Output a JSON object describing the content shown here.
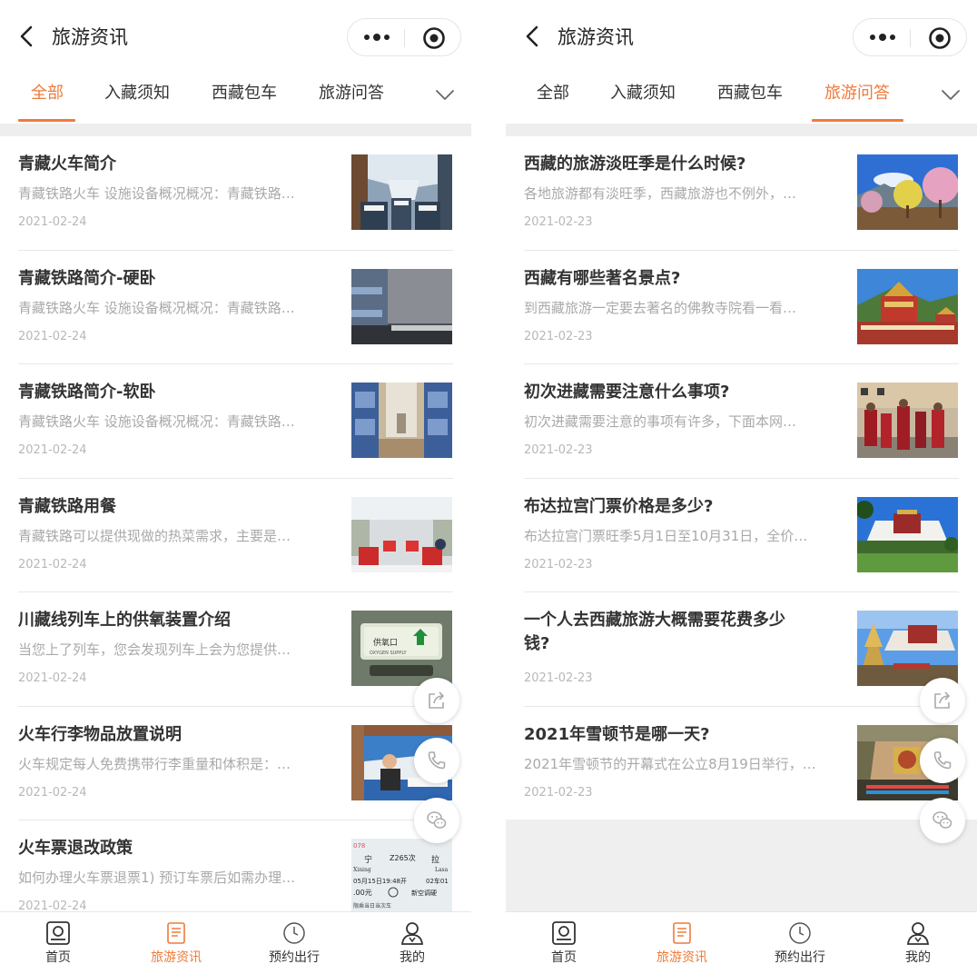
{
  "colors": {
    "accent": "#ef7a3a",
    "title": "#333333",
    "desc": "#a9a9a9",
    "date": "#b8b8b8"
  },
  "panels": [
    {
      "nav_title": "旅游资讯",
      "tabs": [
        "全部",
        "入藏须知",
        "西藏包车",
        "旅游问答"
      ],
      "active_tab": 0,
      "items": [
        {
          "title": "青藏火车简介",
          "desc": "青藏铁路火车 设施设备概况概况：青藏铁路…",
          "date": "2021-02-24",
          "image": "train-seats"
        },
        {
          "title": "青藏铁路简介-硬卧",
          "desc": "青藏铁路火车 设施设备概况概况：青藏铁路…",
          "date": "2021-02-24",
          "image": "hard-sleeper"
        },
        {
          "title": "青藏铁路简介-软卧",
          "desc": "青藏铁路火车 设施设备概况概况：青藏铁路…",
          "date": "2021-02-24",
          "image": "soft-sleeper"
        },
        {
          "title": "青藏铁路用餐",
          "desc": "青藏铁路可以提供现做的热菜需求，主要是…",
          "date": "2021-02-24",
          "image": "dining-car"
        },
        {
          "title": "川藏线列车上的供氧装置介绍",
          "desc": "当您上了列车，您会发现列车上会为您提供…",
          "date": "2021-02-24",
          "image": "oxygen-supply"
        },
        {
          "title": "火车行李物品放置说明",
          "desc": "火车规定每人免费携带行李重量和体积是：…",
          "date": "2021-02-24",
          "image": "train-window"
        },
        {
          "title": "火车票退改政策",
          "desc": "如何办理火车票退票1) 预订车票后如需办理…",
          "date": "2021-02-24",
          "image": "ticket"
        }
      ],
      "oxygen_label": "供氧口",
      "oxygen_sub": "OXYGEN SUPPLY",
      "ticket_text": [
        "078",
        "宁",
        "Z265次",
        "拉",
        "Xining",
        "Lasa",
        "05月15日19:48开",
        "02车01",
        ".00元",
        "新空调硬",
        "限乘当日当次车"
      ],
      "bottom_nav": [
        "首页",
        "旅游资讯",
        "预约出行",
        "我的"
      ],
      "bottom_active": 1
    },
    {
      "nav_title": "旅游资讯",
      "tabs": [
        "全部",
        "入藏须知",
        "西藏包车",
        "旅游问答"
      ],
      "active_tab": 3,
      "items": [
        {
          "title": "西藏的旅游淡旺季是什么时候?",
          "desc": "各地旅游都有淡旺季，西藏旅游也不例外，…",
          "date": "2021-02-23",
          "image": "spring-blossom"
        },
        {
          "title": "西藏有哪些著名景点?",
          "desc": "到西藏旅游一定要去著名的佛教寺院看一看…",
          "date": "2021-02-23",
          "image": "golden-temple"
        },
        {
          "title": "初次进藏需要注意什么事项?",
          "desc": "初次进藏需要注意的事项有许多，下面本网…",
          "date": "2021-02-23",
          "image": "monks"
        },
        {
          "title": "布达拉宫门票价格是多少?",
          "desc": "布达拉宫门票旺季5月1日至10月31日，全价…",
          "date": "2021-02-23",
          "image": "potala"
        },
        {
          "title": "一个人去西藏旅游大概需要花费多少钱?",
          "desc": "",
          "date": "2021-02-23",
          "image": "potala-stupa"
        },
        {
          "title": "2021年雪顿节是哪一天?",
          "desc": "2021年雪顿节的开幕式在公立8月19日举行，…",
          "date": "2021-02-23",
          "image": "thangka-festival"
        }
      ],
      "bottom_nav": [
        "首页",
        "旅游资讯",
        "预约出行",
        "我的"
      ],
      "bottom_active": 1
    }
  ]
}
